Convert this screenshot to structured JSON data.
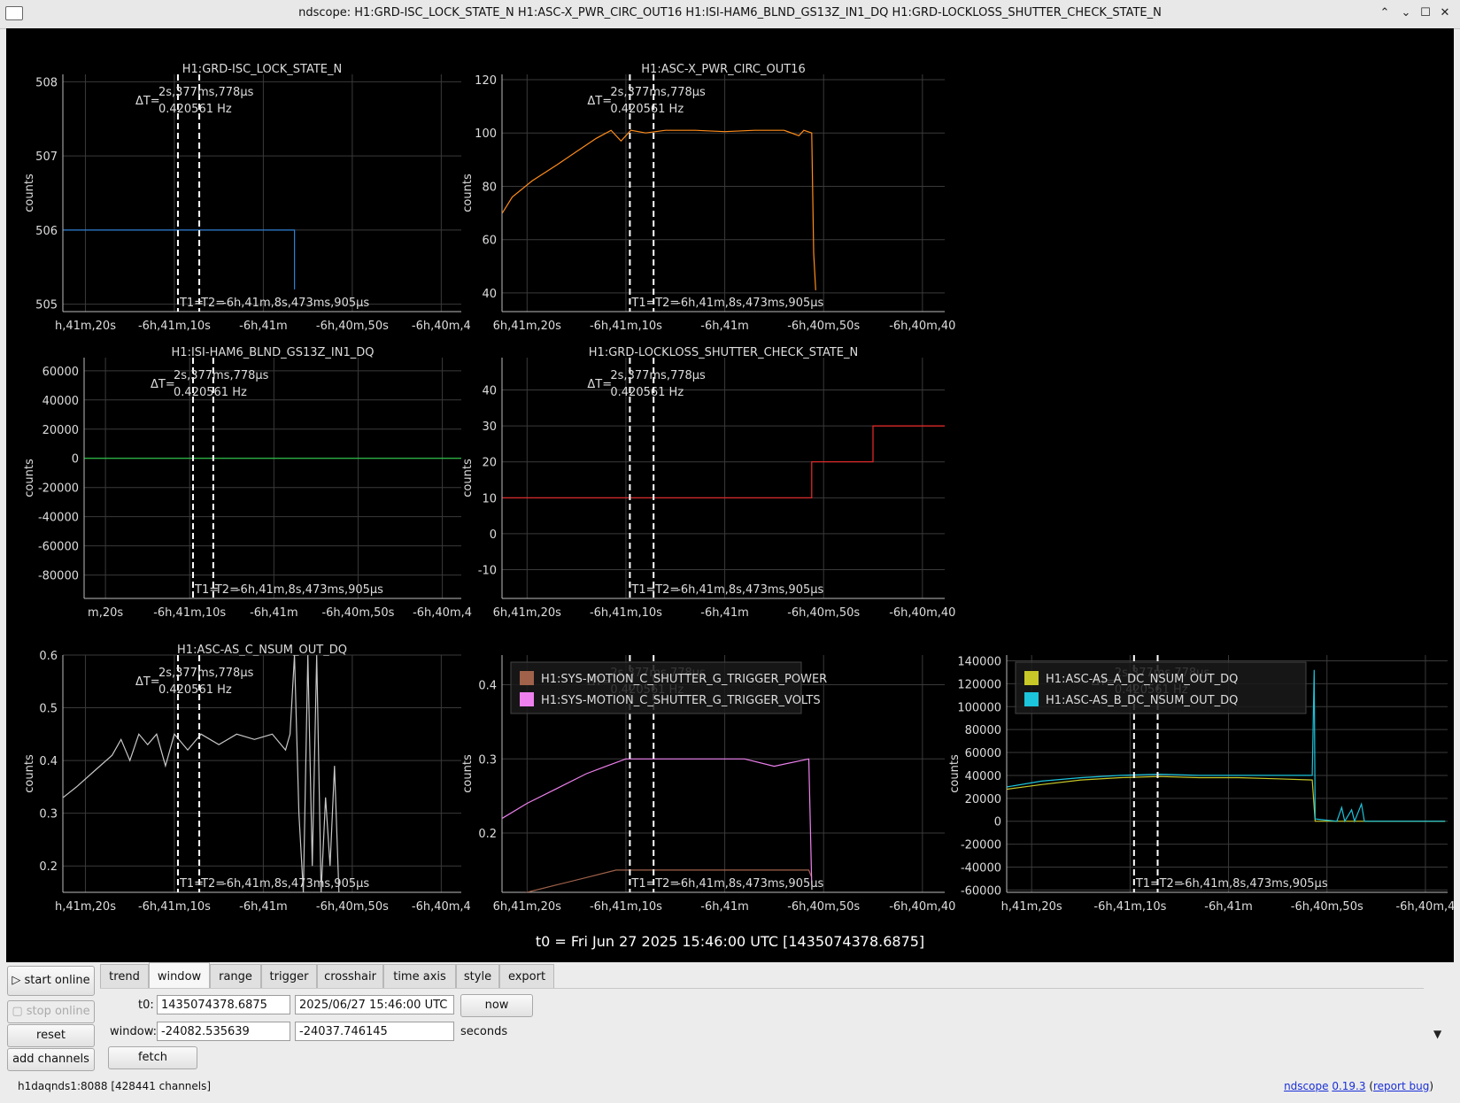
{
  "window": {
    "title": "ndscope: H1:GRD-ISC_LOCK_STATE_N H1:ASC-X_PWR_CIRC_OUT16 H1:ISI-HAM6_BLND_GS13Z_IN1_DQ H1:GRD-LOCKLOSS_SHUTTER_CHECK_STATE_N",
    "controls": {
      "minimize": "⌃",
      "restore": "⌄",
      "maximize": "☐",
      "close": "✕"
    }
  },
  "colors": {
    "plot_bg": "#000000",
    "grid": "#3a3a3a",
    "axis_text": "#dddddd",
    "cursor": "#ffffff",
    "blue": "#2e7fd6",
    "orange": "#ff8c1a",
    "green": "#2ecc4a",
    "red": "#ee2a2a",
    "gray": "#c8c8c8",
    "brown": "#a0624a",
    "pink": "#ee80ee",
    "yellow": "#c8c828",
    "cyan": "#1cc4dc"
  },
  "cursor_readout": {
    "delta_t_label": "ΔT=",
    "delta_t": "2s,377ms,778µs",
    "freq": "0.420561 Hz",
    "t1_label": "T1=",
    "t2_label": "T2=",
    "t_value": "-6h,41m,8s,473ms,905µs"
  },
  "t0_text": "t0 = Fri Jun 27 2025 15:46:00 UTC [1435074378.6875]",
  "chart_data": [
    {
      "type": "line",
      "title": "H1:GRD-ISC_LOCK_STATE_N",
      "ylabel": "counts",
      "ylim": [
        504.9,
        508.1
      ],
      "yticks": [
        "505",
        "506",
        "507",
        "508"
      ],
      "xticks": [
        "h,41m,20s",
        "-6h,41m,10s",
        "-6h,41m",
        "-6h,40m,50s",
        "-6h,40m,4"
      ],
      "series": [
        {
          "color": "#2e7fd6",
          "points": [
            [
              -24082.5,
              506
            ],
            [
              -24056.5,
              506
            ],
            [
              -24056.5,
              505.2
            ]
          ]
        }
      ]
    },
    {
      "type": "line",
      "title": "H1:ASC-X_PWR_CIRC_OUT16",
      "ylabel": "counts",
      "ylim": [
        33,
        122
      ],
      "yticks": [
        "40",
        "60",
        "80",
        "100",
        "120"
      ],
      "xticks": [
        "6h,41m,20s",
        "-6h,41m,10s",
        "-6h,41m",
        "-6h,40m,50s",
        "-6h,40m,40"
      ],
      "series": [
        {
          "color": "#ff8c1a",
          "points": [
            [
              -24082.5,
              70
            ],
            [
              -24081.5,
              76
            ],
            [
              -24079.5,
              82
            ],
            [
              -24077,
              88
            ],
            [
              -24075,
              93
            ],
            [
              -24073,
              98
            ],
            [
              -24071.5,
              101
            ],
            [
              -24070.5,
              97
            ],
            [
              -24069.5,
              101
            ],
            [
              -24068,
              100
            ],
            [
              -24066,
              101
            ],
            [
              -24063,
              101
            ],
            [
              -24060,
              100.5
            ],
            [
              -24057,
              101
            ],
            [
              -24054,
              101
            ],
            [
              -24052.5,
              99
            ],
            [
              -24052,
              101
            ],
            [
              -24051.2,
              100
            ],
            [
              -24051,
              55
            ],
            [
              -24050.8,
              41
            ]
          ]
        }
      ]
    },
    {
      "type": "line",
      "title": "H1:ISI-HAM6_BLND_GS13Z_IN1_DQ",
      "ylabel": "counts",
      "ylim": [
        -96000,
        69000
      ],
      "yticks": [
        "-80000",
        "-60000",
        "-40000",
        "-20000",
        "0",
        "20000",
        "40000",
        "60000"
      ],
      "xticks": [
        "m,20s",
        "-6h,41m,10s",
        "-6h,41m",
        "-6h,40m,50s",
        "-6h,40m,4"
      ],
      "series": [
        {
          "color": "#2ecc4a",
          "points": [
            [
              -24082.5,
              0
            ],
            [
              -24037.7,
              0
            ]
          ]
        }
      ]
    },
    {
      "type": "line",
      "title": "H1:GRD-LOCKLOSS_SHUTTER_CHECK_STATE_N",
      "ylabel": "counts",
      "ylim": [
        -18,
        49
      ],
      "yticks": [
        "-10",
        "0",
        "10",
        "20",
        "30",
        "40"
      ],
      "xticks": [
        "6h,41m,20s",
        "-6h,41m,10s",
        "-6h,41m",
        "-6h,40m,50s",
        "-6h,40m,40"
      ],
      "series": [
        {
          "color": "#ee2a2a",
          "points": [
            [
              -24082.5,
              10
            ],
            [
              -24051.2,
              10
            ],
            [
              -24051.2,
              20
            ],
            [
              -24045,
              20
            ],
            [
              -24045,
              30
            ],
            [
              -24030,
              30
            ]
          ]
        }
      ]
    },
    {
      "type": "line",
      "title": "H1:ASC-AS_C_NSUM_OUT_DQ",
      "ylabel": "counts",
      "ylim": [
        0.15,
        0.6
      ],
      "yticks": [
        "0.2",
        "0.3",
        "0.4",
        "0.5",
        "0.6"
      ],
      "xticks": [
        "h,41m,20s",
        "-6h,41m,10s",
        "-6h,41m",
        "-6h,40m,50s",
        "-6h,40m,4"
      ],
      "series": [
        {
          "color": "#c8c8c8",
          "points": [
            [
              -24082.5,
              0.33
            ],
            [
              -24081,
              0.35
            ],
            [
              -24079,
              0.38
            ],
            [
              -24077,
              0.41
            ],
            [
              -24076,
              0.44
            ],
            [
              -24075,
              0.4
            ],
            [
              -24074,
              0.45
            ],
            [
              -24073,
              0.43
            ],
            [
              -24072,
              0.45
            ],
            [
              -24071,
              0.39
            ],
            [
              -24070,
              0.45
            ],
            [
              -24068.5,
              0.42
            ],
            [
              -24067,
              0.45
            ],
            [
              -24065,
              0.43
            ],
            [
              -24063,
              0.45
            ],
            [
              -24061,
              0.44
            ],
            [
              -24059,
              0.45
            ],
            [
              -24057.5,
              0.42
            ],
            [
              -24057,
              0.45
            ],
            [
              -24056.5,
              0.6
            ],
            [
              -24056,
              0.3
            ],
            [
              -24055.5,
              0.15
            ],
            [
              -24055,
              0.6
            ],
            [
              -24054.5,
              0.2
            ],
            [
              -24054,
              0.6
            ],
            [
              -24053.5,
              0.15
            ],
            [
              -24053,
              0.33
            ],
            [
              -24052.5,
              0.2
            ],
            [
              -24052,
              0.39
            ],
            [
              -24051.5,
              0.15
            ]
          ]
        }
      ]
    },
    {
      "type": "line",
      "title": "",
      "ylabel": "counts",
      "ylim": [
        0.12,
        0.44
      ],
      "yticks": [
        "0.2",
        "0.3",
        "0.4"
      ],
      "xticks": [
        "6h,41m,20s",
        "-6h,41m,10s",
        "-6h,41m",
        "-6h,40m,50s",
        "-6h,40m,40"
      ],
      "legend": [
        {
          "label": "H1:SYS-MOTION_C_SHUTTER_G_TRIGGER_POWER",
          "color": "#a0624a"
        },
        {
          "label": "H1:SYS-MOTION_C_SHUTTER_G_TRIGGER_VOLTS",
          "color": "#ee80ee"
        }
      ],
      "series": [
        {
          "name": "H1:SYS-MOTION_C_SHUTTER_G_TRIGGER_POWER",
          "color": "#a0624a",
          "points": [
            [
              -24082.5,
              0.11
            ],
            [
              -24080,
              0.12
            ],
            [
              -24077,
              0.13
            ],
            [
              -24074,
              0.14
            ],
            [
              -24071,
              0.15
            ],
            [
              -24068,
              0.15
            ],
            [
              -24064,
              0.15
            ],
            [
              -24060,
              0.15
            ],
            [
              -24056,
              0.15
            ],
            [
              -24051.5,
              0.15
            ],
            [
              -24051.2,
              0.14
            ]
          ]
        },
        {
          "name": "H1:SYS-MOTION_C_SHUTTER_G_TRIGGER_VOLTS",
          "color": "#ee80ee",
          "points": [
            [
              -24082.5,
              0.22
            ],
            [
              -24080,
              0.24
            ],
            [
              -24077,
              0.26
            ],
            [
              -24074,
              0.28
            ],
            [
              -24072,
              0.29
            ],
            [
              -24070,
              0.3
            ],
            [
              -24067,
              0.3
            ],
            [
              -24064,
              0.3
            ],
            [
              -24061,
              0.3
            ],
            [
              -24058,
              0.3
            ],
            [
              -24055,
              0.29
            ],
            [
              -24051.5,
              0.3
            ],
            [
              -24051.2,
              0.13
            ]
          ]
        }
      ]
    },
    {
      "type": "line",
      "title": "",
      "ylabel": "counts",
      "ylim": [
        -62000,
        145000
      ],
      "yticks": [
        "-60000",
        "-40000",
        "-20000",
        "0",
        "20000",
        "40000",
        "60000",
        "80000",
        "100000",
        "120000",
        "140000"
      ],
      "xticks": [
        "h,41m,20s",
        "-6h,41m,10s",
        "-6h,41m",
        "-6h,40m,50s",
        "-6h,40m,4"
      ],
      "legend": [
        {
          "label": "H1:ASC-AS_A_DC_NSUM_OUT_DQ",
          "color": "#c8c828"
        },
        {
          "label": "H1:ASC-AS_B_DC_NSUM_OUT_DQ",
          "color": "#1cc4dc"
        }
      ],
      "series": [
        {
          "name": "H1:ASC-AS_A_DC_NSUM_OUT_DQ",
          "color": "#c8c828",
          "points": [
            [
              -24082.5,
              28000
            ],
            [
              -24079,
              32000
            ],
            [
              -24075,
              36000
            ],
            [
              -24071,
              38000
            ],
            [
              -24067,
              39000
            ],
            [
              -24063,
              38000
            ],
            [
              -24059,
              38000
            ],
            [
              -24055,
              37000
            ],
            [
              -24051.5,
              36000
            ],
            [
              -24051.2,
              0
            ],
            [
              -24038,
              0
            ]
          ]
        },
        {
          "name": "H1:ASC-AS_B_DC_NSUM_OUT_DQ",
          "color": "#1cc4dc",
          "points": [
            [
              -24082.5,
              30000
            ],
            [
              -24079,
              35000
            ],
            [
              -24075,
              38000
            ],
            [
              -24071,
              40000
            ],
            [
              -24067,
              41000
            ],
            [
              -24063,
              40000
            ],
            [
              -24059,
              40000
            ],
            [
              -24055,
              40000
            ],
            [
              -24051.5,
              40000
            ],
            [
              -24051.3,
              132000
            ],
            [
              -24051.2,
              2000
            ],
            [
              -24049,
              0
            ],
            [
              -24048.5,
              12000
            ],
            [
              -24048.2,
              0
            ],
            [
              -24047.5,
              10000
            ],
            [
              -24047.2,
              0
            ],
            [
              -24046.5,
              15000
            ],
            [
              -24046.2,
              0
            ],
            [
              -24038,
              0
            ]
          ]
        }
      ]
    }
  ],
  "sidebar": {
    "start_online": "▷ start online",
    "stop_online": "▢ stop online",
    "reset": "reset",
    "add_channels": "add channels"
  },
  "tabs": [
    "trend",
    "window",
    "range",
    "trigger",
    "crosshair",
    "time axis",
    "style",
    "export"
  ],
  "active_tab": "window",
  "window_tab": {
    "t0_label": "t0:",
    "t0_gps": "1435074378.6875",
    "t0_utc": "2025/06/27 15:46:00 UTC",
    "now_button": "now",
    "window_label": "window:",
    "window_start": "-24082.535639",
    "window_end": "-24037.746145",
    "units": "seconds",
    "fetch_button": "fetch",
    "collapse": "▼"
  },
  "status": "h1daqnds1:8088  [428441 channels]",
  "footer": {
    "app": "ndscope",
    "version": "0.19.3",
    "open_paren": "(",
    "report": "report bug",
    "close_paren": ")"
  }
}
